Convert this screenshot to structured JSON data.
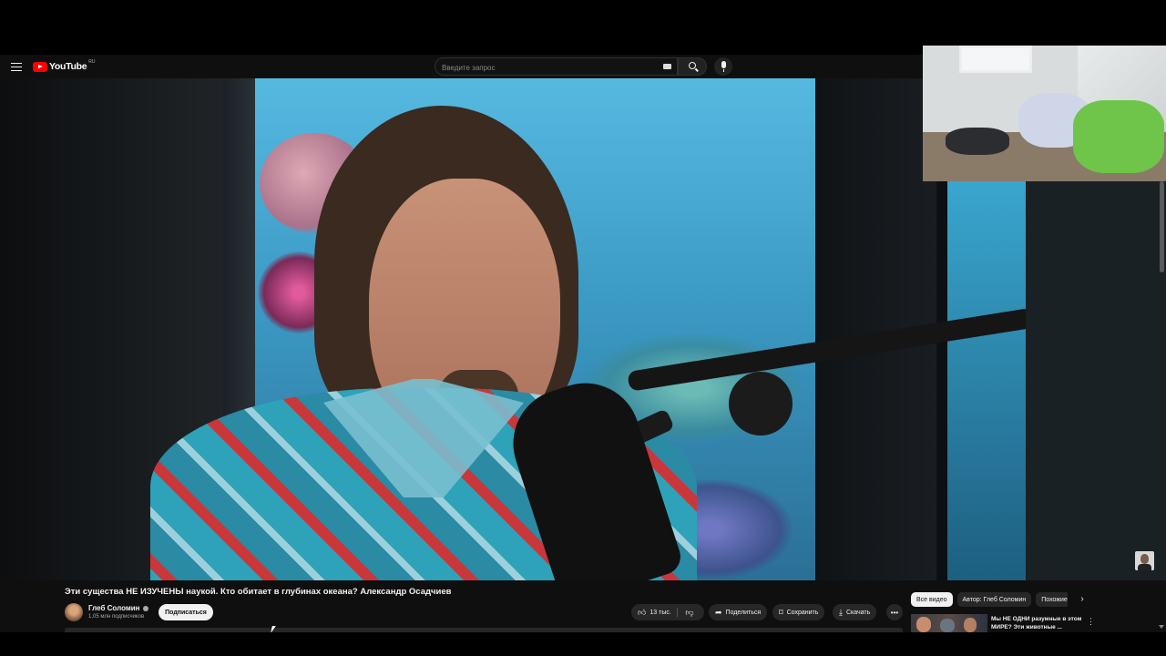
{
  "masthead": {
    "logo_text": "YouTube",
    "region": "RU",
    "search_placeholder": "Введите запрос"
  },
  "video": {
    "title": "Эти существа НЕ ИЗУЧЕНЫ наукой. Кто обитает в глубинах океана? Александр Осадчиев"
  },
  "channel": {
    "name": "Глеб Соломин",
    "subscribers": "1,05 млн подписчиков",
    "subscribe_label": "Подписаться"
  },
  "actions": {
    "likes": "13 тыс.",
    "share": "Поделиться",
    "save": "Сохранить",
    "download": "Скачать"
  },
  "chips": [
    {
      "label": "Все видео",
      "active": true
    },
    {
      "label": "Автор: Глеб Соломин",
      "active": false
    },
    {
      "label": "Похожие",
      "active": false
    }
  ],
  "recommendation": {
    "title": "Мы НЕ ОДНИ разумные в этом МИРЕ? Эти животные ..."
  },
  "icons": {
    "menu": "menu-icon",
    "search": "search-icon",
    "keyboard": "keyboard-icon",
    "mic": "microphone-icon",
    "like": "thumbs-up-icon",
    "dislike": "thumbs-down-icon",
    "share": "share-icon",
    "save": "bookmark-icon",
    "download": "download-icon",
    "more": "more-horizontal-icon",
    "chips_next": "chevron-right-icon",
    "rec_more": "more-vertical-icon"
  },
  "colors": {
    "background": "#0f0f0f",
    "brand_red": "#ff0000",
    "pill": "#272727",
    "text": "#f1f1f1",
    "secondary_text": "#aaaaaa"
  }
}
